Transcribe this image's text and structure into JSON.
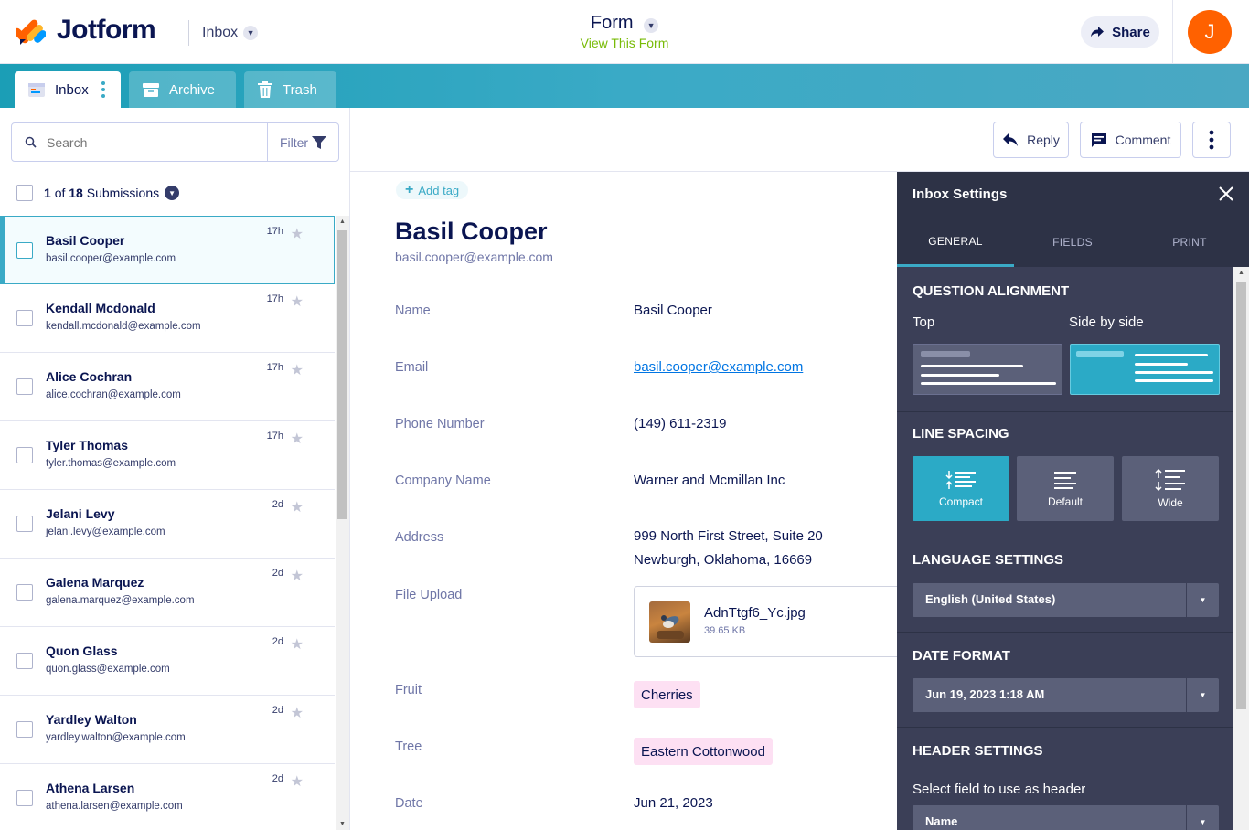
{
  "header": {
    "brand": "Jotform",
    "inbox_label": "Inbox",
    "form_title": "Form",
    "form_subtitle": "View This Form",
    "share_label": "Share",
    "avatar_initial": "J"
  },
  "tabs": [
    {
      "label": "Inbox",
      "active": true
    },
    {
      "label": "Archive",
      "active": false
    },
    {
      "label": "Trash",
      "active": false
    }
  ],
  "search": {
    "placeholder": "Search",
    "filter_label": "Filter"
  },
  "submission_count": {
    "current": "1",
    "of": "of",
    "total": "18",
    "label": "Submissions"
  },
  "submissions": [
    {
      "name": "Basil Cooper",
      "email": "basil.cooper@example.com",
      "time": "17h",
      "selected": true
    },
    {
      "name": "Kendall Mcdonald",
      "email": "kendall.mcdonald@example.com",
      "time": "17h"
    },
    {
      "name": "Alice Cochran",
      "email": "alice.cochran@example.com",
      "time": "17h"
    },
    {
      "name": "Tyler Thomas",
      "email": "tyler.thomas@example.com",
      "time": "17h"
    },
    {
      "name": "Jelani Levy",
      "email": "jelani.levy@example.com",
      "time": "2d"
    },
    {
      "name": "Galena Marquez",
      "email": "galena.marquez@example.com",
      "time": "2d"
    },
    {
      "name": "Quon Glass",
      "email": "quon.glass@example.com",
      "time": "2d"
    },
    {
      "name": "Yardley Walton",
      "email": "yardley.walton@example.com",
      "time": "2d"
    },
    {
      "name": "Athena Larsen",
      "email": "athena.larsen@example.com",
      "time": "2d"
    }
  ],
  "actions": {
    "reply": "Reply",
    "comment": "Comment"
  },
  "detail": {
    "add_tag": "Add tag",
    "title": "Basil Cooper",
    "subtitle": "basil.cooper@example.com",
    "fields": {
      "name": {
        "label": "Name",
        "value": "Basil Cooper"
      },
      "email": {
        "label": "Email",
        "value": "basil.cooper@example.com"
      },
      "phone": {
        "label": "Phone Number",
        "value": "(149) 611-2319"
      },
      "company": {
        "label": "Company Name",
        "value": "Warner and Mcmillan Inc"
      },
      "address": {
        "label": "Address",
        "line1": "999 North First Street, Suite 20",
        "line2": "Newburgh, Oklahoma, 16669"
      },
      "file": {
        "label": "File Upload",
        "file_name": "AdnTtgf6_Yc.jpg",
        "file_size": "39.65 KB"
      },
      "fruit": {
        "label": "Fruit",
        "value": "Cherries"
      },
      "tree": {
        "label": "Tree",
        "value": "Eastern Cottonwood"
      },
      "date": {
        "label": "Date",
        "value": "Jun 21, 2023"
      }
    }
  },
  "settings": {
    "title": "Inbox Settings",
    "tabs": {
      "general": "GENERAL",
      "fields": "FIELDS",
      "print": "PRINT"
    },
    "question_alignment": {
      "heading": "QUESTION ALIGNMENT",
      "top": "Top",
      "side": "Side by side",
      "selected": "Side by side"
    },
    "line_spacing": {
      "heading": "LINE SPACING",
      "compact": "Compact",
      "default": "Default",
      "wide": "Wide",
      "selected": "Compact"
    },
    "language": {
      "heading": "LANGUAGE SETTINGS",
      "value": "English (United States)"
    },
    "date_format": {
      "heading": "DATE FORMAT",
      "value": "Jun 19, 2023 1:18 AM"
    },
    "header_settings": {
      "heading": "HEADER SETTINGS",
      "prompt": "Select field to use as header",
      "value": "Name"
    }
  },
  "colors": {
    "accent": "#3aaac6",
    "navy": "#0a1551",
    "avatar": "#ff6100",
    "link": "#0075e3",
    "view_form": "#78bb07",
    "tag_pink": "#fde0f3",
    "settings_bg": "#3b3f57"
  }
}
